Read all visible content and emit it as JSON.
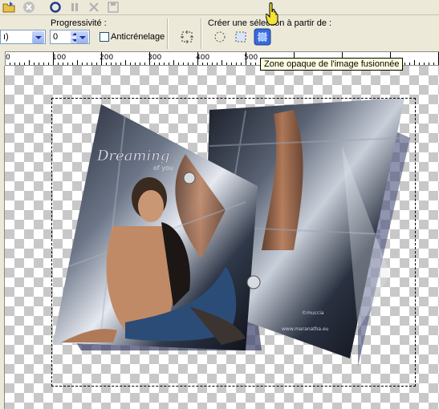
{
  "toolbar": {
    "icons": [
      "open-folder-icon",
      "cancel-icon",
      "record-icon",
      "pause-icon",
      "stop-x-icon",
      "save-disk-icon"
    ]
  },
  "options": {
    "combo_mode_value": "ı)",
    "progressivity_label": "Progressivité :",
    "progressivity_value": "0",
    "antialias_label": "Anticrénelage",
    "create_selection_label": "Créer une sélection à partir de :"
  },
  "tooltip": "Zone opaque de l'image fusionnée",
  "ruler": {
    "labels": [
      "0",
      "100",
      "200",
      "300",
      "400",
      "500"
    ]
  },
  "artwork": {
    "title_text": "Dreaming",
    "subtitle_text": "of you",
    "credit_text": "©muccia",
    "url_text": "www.maranatha.eu"
  },
  "colors": {
    "chrome": "#ece9d8",
    "tooltip_bg": "#ffffe1",
    "active_button": "#3a6ad8"
  }
}
